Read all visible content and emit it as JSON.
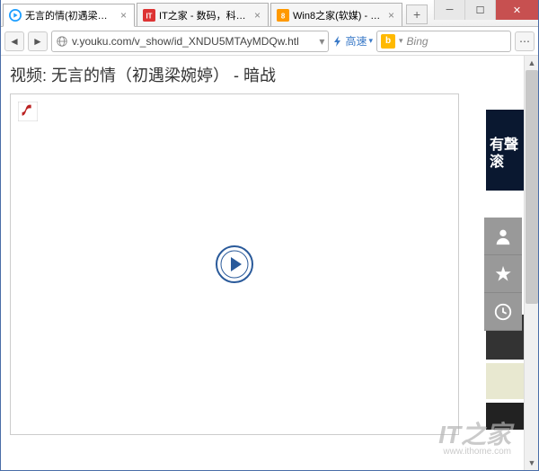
{
  "tabs": [
    {
      "title": "无言的情(初遇梁婉婷...",
      "active": true,
      "favicon": "youku"
    },
    {
      "title": "IT之家 - 数码，科技，...",
      "active": false,
      "favicon": "ithome"
    },
    {
      "title": "Win8之家(软媒) - Win...",
      "active": false,
      "favicon": "win8"
    }
  ],
  "address": {
    "url": "v.youku.com/v_show/id_XNDU5MTAyMDQw.htl",
    "dropdown": "▾"
  },
  "speed": {
    "label": "高速",
    "dropdown": "▾"
  },
  "search": {
    "placeholder": "Bing",
    "dropdown": "▾"
  },
  "video": {
    "title": "视频: 无言的情（初遇梁婉婷） - 暗战"
  },
  "sidebanner": {
    "line1": "有聲",
    "line2": "滚"
  },
  "watermark": {
    "brand": "IT之家",
    "url": "www.ithome.com"
  }
}
